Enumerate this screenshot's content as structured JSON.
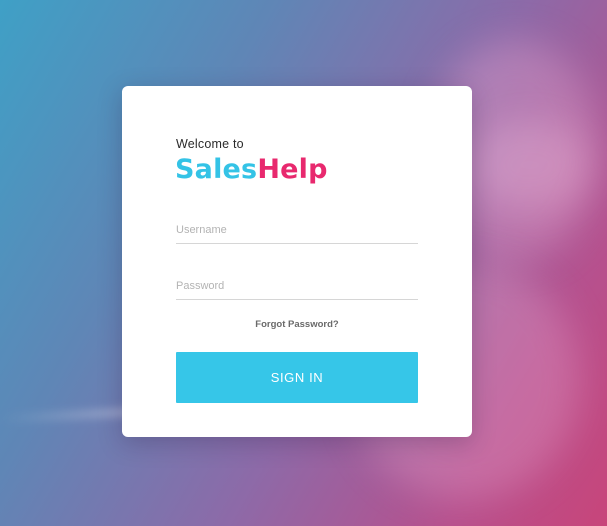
{
  "login": {
    "welcome_text": "Welcome to",
    "brand": {
      "part1": "Sales",
      "part2": "Help"
    },
    "username": {
      "placeholder": "Username",
      "value": ""
    },
    "password": {
      "placeholder": "Password",
      "value": ""
    },
    "forgot_label": "Forgot Password?",
    "signin_label": "SIGN IN"
  },
  "theme": {
    "brand_blue": "#34c3e6",
    "brand_pink": "#e8296e",
    "button_color": "#36c6e8",
    "background_start": "#3fa0c6",
    "background_end": "#c8457a"
  }
}
